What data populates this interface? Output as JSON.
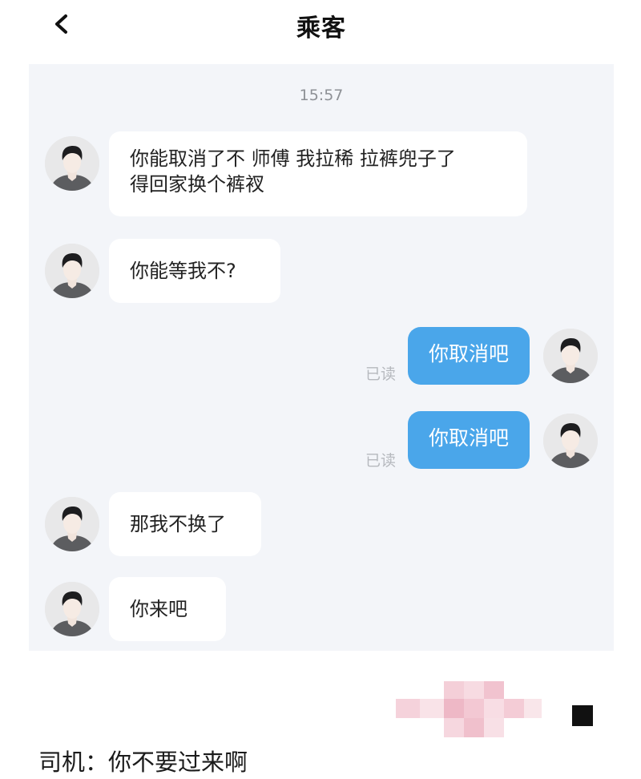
{
  "header": {
    "title": "乘客"
  },
  "chat": {
    "timestamp": "15:57",
    "read_label": "已读",
    "messages": [
      {
        "side": "left",
        "text": "你能取消了不 师傅 我拉稀 拉裤兜子了\n得回家换个裤衩"
      },
      {
        "side": "left",
        "text": "你能等我不?"
      },
      {
        "side": "right",
        "text": "你取消吧",
        "status": "已读"
      },
      {
        "side": "right",
        "text": "你取消吧",
        "status": "已读"
      },
      {
        "side": "left",
        "text": "那我不换了"
      },
      {
        "side": "left",
        "text": "你来吧"
      }
    ]
  },
  "caption": "司机：你不要过来啊",
  "colors": {
    "bubble_mine": "#4aa6ea",
    "chat_bg": "#f3f5f9",
    "bubble_other": "#ffffff"
  }
}
